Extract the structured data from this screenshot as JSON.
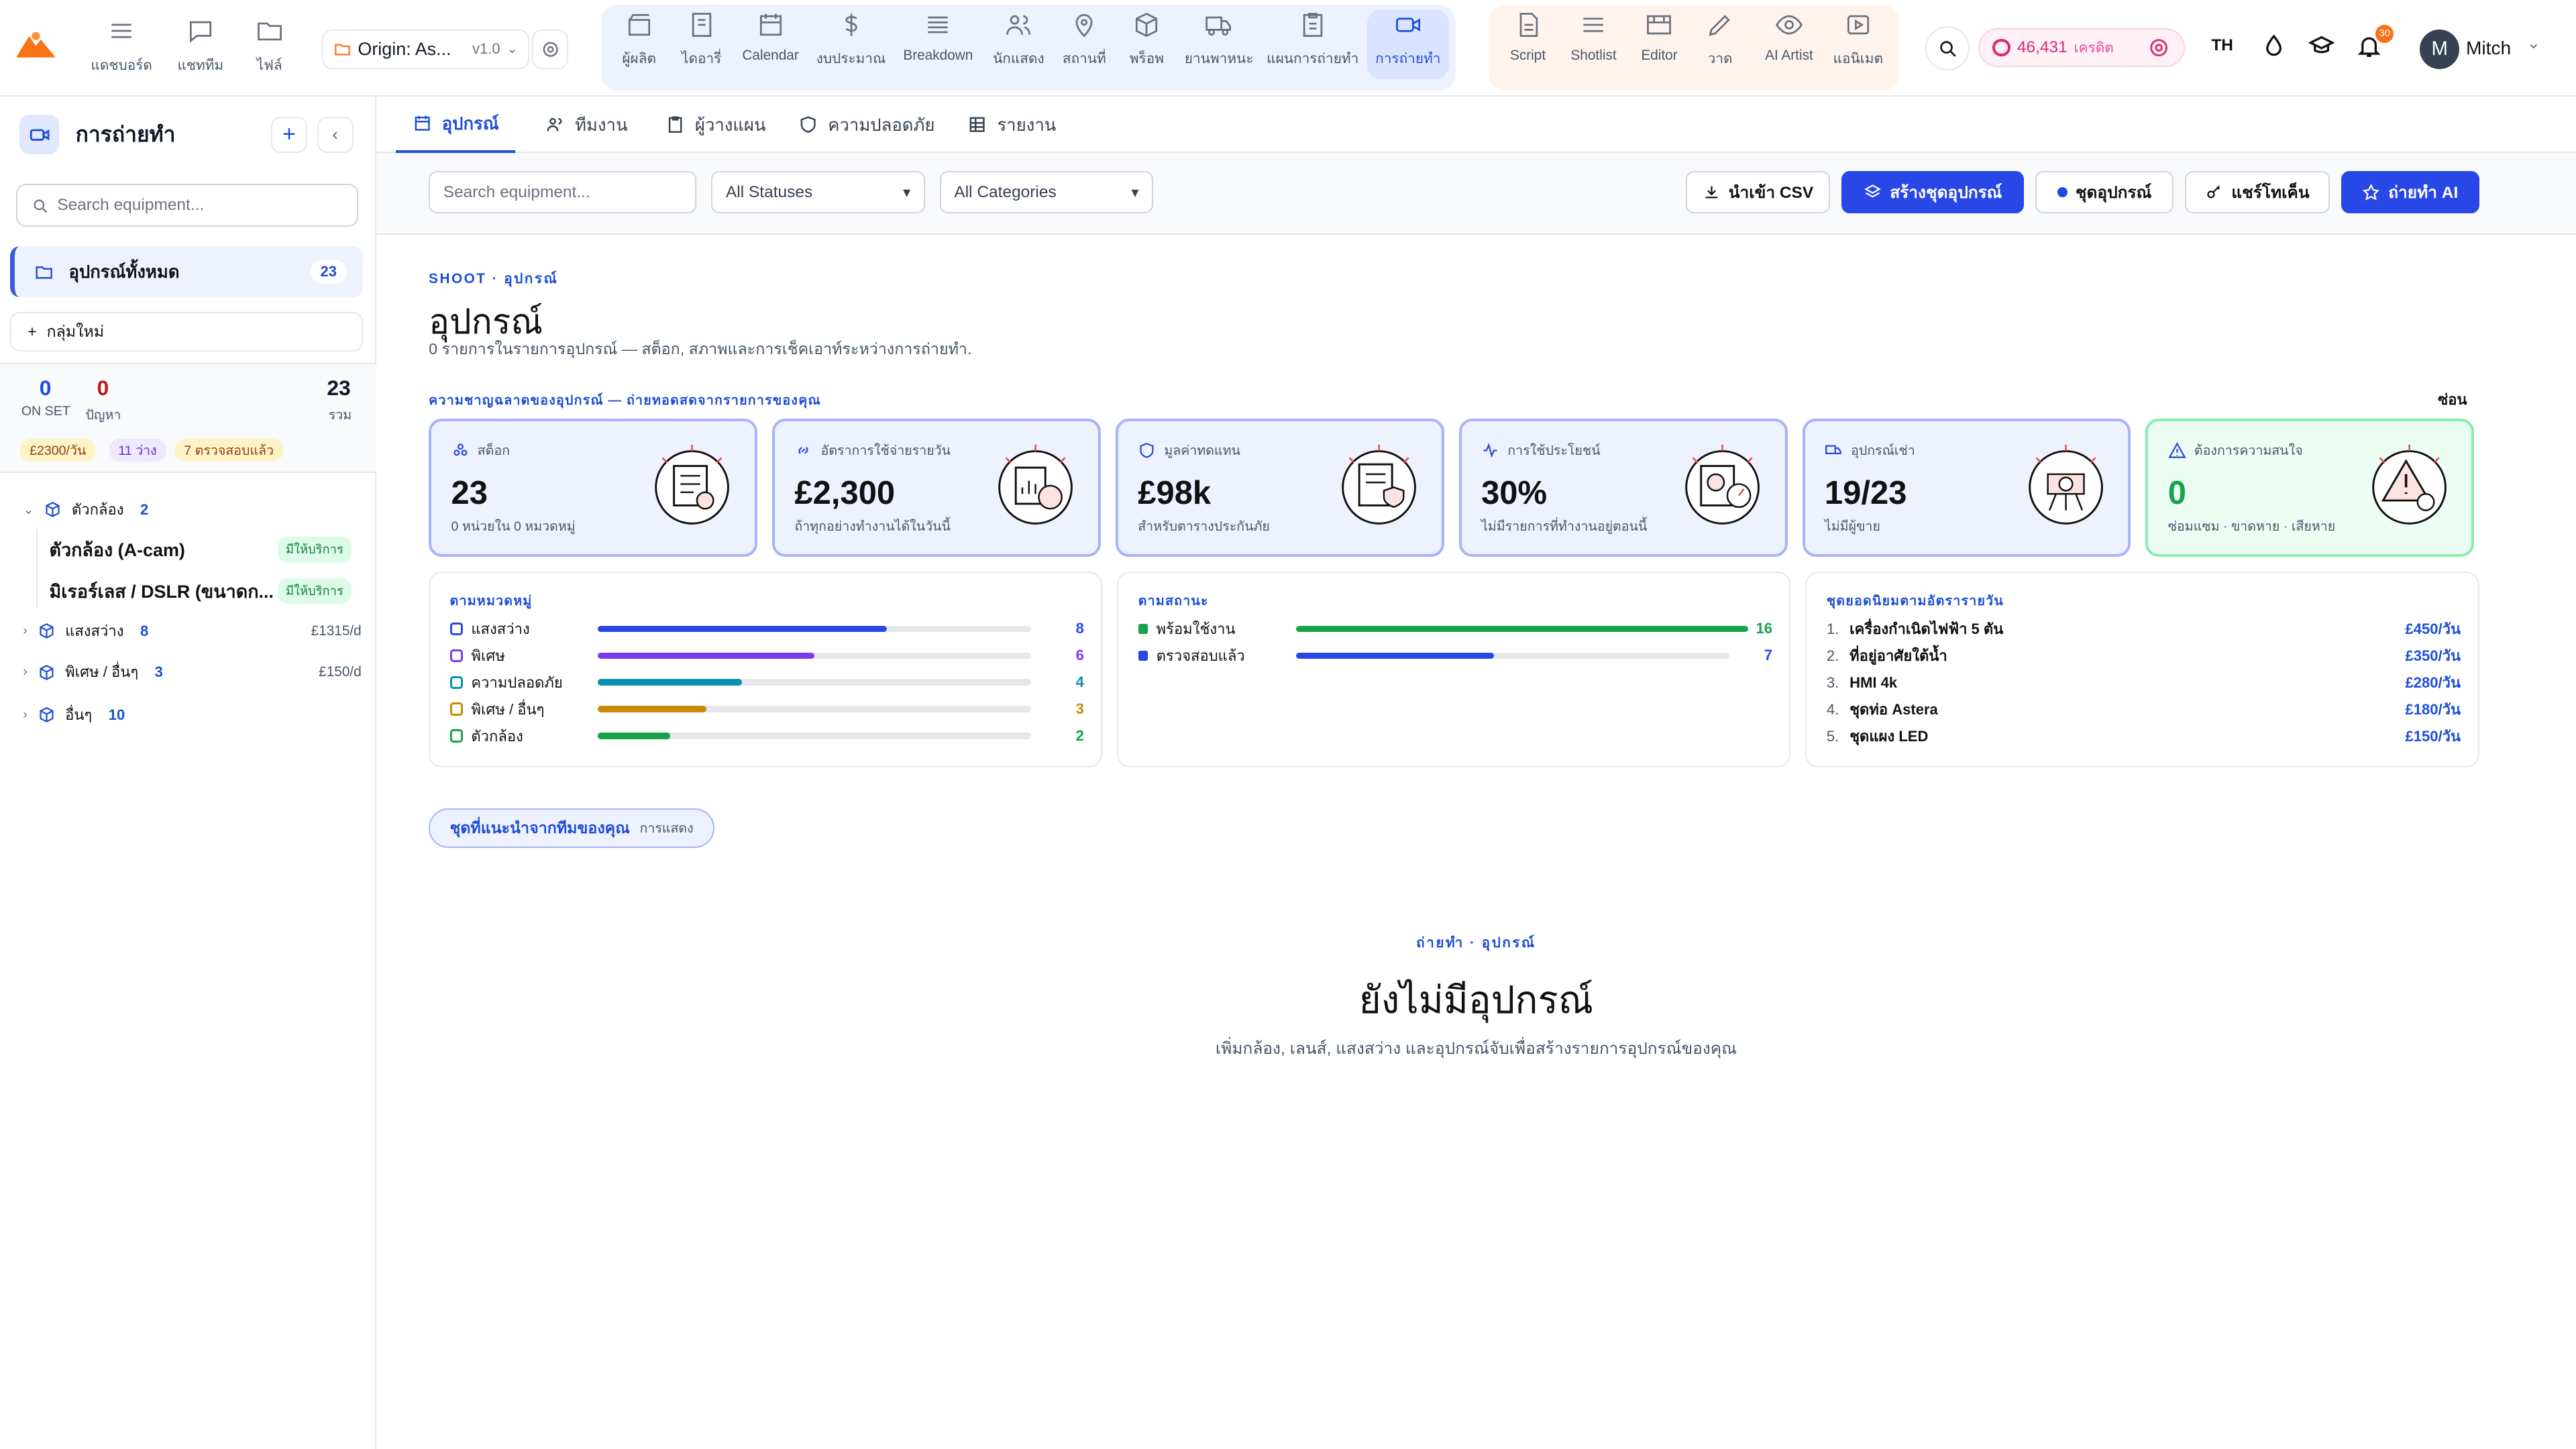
{
  "topnav": {
    "left": [
      {
        "label": "แดชบอร์ด",
        "icon": "menu-icon"
      },
      {
        "label": "แชททีม",
        "icon": "chat-icon"
      },
      {
        "label": "ไฟล์",
        "icon": "folder-icon"
      }
    ],
    "project": {
      "name": "Origin: As...",
      "version": "v1.0"
    },
    "group1": [
      {
        "label": "ผู้ผลิต",
        "icon": "clapper-icon"
      },
      {
        "label": "ไดอารี่",
        "icon": "notebook-icon"
      },
      {
        "label": "Calendar",
        "icon": "calendar-icon"
      },
      {
        "label": "งบประมาณ",
        "icon": "dollar-icon"
      },
      {
        "label": "Breakdown",
        "icon": "layers-icon"
      },
      {
        "label": "นักแสดง",
        "icon": "people-icon"
      },
      {
        "label": "สถานที่",
        "icon": "pin-icon"
      },
      {
        "label": "พร็อพ",
        "icon": "box-icon"
      },
      {
        "label": "ยานพาหนะ",
        "icon": "truck-icon"
      },
      {
        "label": "แผนการถ่ายทำ",
        "icon": "clipboard-icon"
      },
      {
        "label": "การถ่ายทำ",
        "icon": "camera-icon",
        "active": true
      }
    ],
    "group2": [
      {
        "label": "Script",
        "icon": "doc-icon"
      },
      {
        "label": "Shotlist",
        "icon": "list-icon"
      },
      {
        "label": "Editor",
        "icon": "film-icon"
      },
      {
        "label": "วาด",
        "icon": "pencil-icon"
      },
      {
        "label": "AI Artist",
        "icon": "eye-icon"
      },
      {
        "label": "แอนิเมต",
        "icon": "play-icon"
      }
    ],
    "credits": {
      "value": "46,431",
      "label": "เครดิต"
    },
    "lang": "TH",
    "notifications": "30",
    "user": {
      "initial": "M",
      "name": "Mitch"
    }
  },
  "sidebar": {
    "title": "การถ่ายทำ",
    "search_placeholder": "Search equipment...",
    "all": {
      "label": "อุปกรณ์ทั้งหมด",
      "count": "23"
    },
    "new_group": "กลุ่มใหม่",
    "stats": {
      "on_set": "0",
      "on_set_label": "ON SET",
      "issues": "0",
      "issues_label": "ปัญหา",
      "total": "23",
      "total_label": "รวม"
    },
    "chips": [
      "£2300/วัน",
      "11 ว่าง",
      "7 ตรวจสอบแล้ว"
    ],
    "tree": [
      {
        "label": "ตัวกล้อง",
        "count": "2",
        "rate": "",
        "expanded": true,
        "children": [
          {
            "label": "ตัวกล้อง (A-cam)",
            "badge": "มีให้บริการ"
          },
          {
            "label": "มิเรอร์เลส / DSLR (ขนาดก...",
            "badge": "มีให้บริการ"
          }
        ]
      },
      {
        "label": "แสงสว่าง",
        "count": "8",
        "rate": "£1315/d"
      },
      {
        "label": "พิเศษ / อื่นๆ",
        "count": "3",
        "rate": "£150/d"
      },
      {
        "label": "อื่นๆ",
        "count": "10",
        "rate": ""
      }
    ]
  },
  "tabs": [
    {
      "label": "อุปกรณ์",
      "icon": "calendar-icon",
      "active": true
    },
    {
      "label": "ทีมงาน",
      "icon": "people-icon"
    },
    {
      "label": "ผู้วางแผน",
      "icon": "clipboard-icon"
    },
    {
      "label": "ความปลอดภัย",
      "icon": "shield-icon"
    },
    {
      "label": "รายงาน",
      "icon": "grid-icon"
    }
  ],
  "filters": {
    "search_placeholder": "Search equipment...",
    "status": "All Statuses",
    "category": "All Categories",
    "import_csv": "นำเข้า CSV",
    "create_kit": "สร้างชุดอุปกรณ์",
    "kits": "ชุดอุปกรณ์",
    "share_token": "แชร์โทเค็น",
    "ai_shoot": "ถ่ายทำ AI"
  },
  "header": {
    "eyebrow": "SHOOT · อุปกรณ์",
    "title": "อุปกรณ์",
    "subtitle": "0 รายการในรายการอุปกรณ์ — สต็อก, สภาพและการเช็คเอาท์ระหว่างการถ่ายทำ."
  },
  "insights": {
    "title": "ความชาญฉลาดของอุปกรณ์ — ถ่ายทอดสดจากรายการของคุณ",
    "hide": "ซ่อน"
  },
  "cards": [
    {
      "title": "สต็อก",
      "value": "23",
      "sub": "0 หน่วยใน 0 หมวดหมู่",
      "icon": "stack-icon",
      "color": "blue"
    },
    {
      "title": "อัตราการใช้จ่ายรายวัน",
      "value": "£2,300",
      "sub": "ถ้าทุกอย่างทำงานได้ในวันนี้",
      "icon": "link-icon",
      "color": "blue"
    },
    {
      "title": "มูลค่าทดแทน",
      "value": "£98k",
      "sub": "สำหรับตารางประกันภัย",
      "icon": "shield-icon",
      "color": "blue"
    },
    {
      "title": "การใช้ประโยชน์",
      "value": "30%",
      "sub": "ไม่มีรายการที่ทำงานอยู่ตอนนี้",
      "icon": "pulse-icon",
      "color": "blue"
    },
    {
      "title": "อุปกรณ์เช่า",
      "value": "19/23",
      "sub": "ไม่มีผู้ขาย",
      "icon": "truck-icon",
      "color": "blue"
    },
    {
      "title": "ต้องการความสนใจ",
      "value": "0",
      "sub": "ซ่อมแซม · ขาดหาย · เสียหาย",
      "icon": "warning-icon",
      "color": "green"
    }
  ],
  "by_category": {
    "title": "ตามหมวดหมู่",
    "max": 8,
    "items": [
      {
        "label": "แสงสว่าง",
        "value": 8,
        "color": "#2847e6",
        "icon": "bulb-icon"
      },
      {
        "label": "พิเศษ",
        "value": 6,
        "color": "#7c3aed",
        "icon": "cube-icon"
      },
      {
        "label": "ความปลอดภัย",
        "value": 4,
        "color": "#0891b2",
        "icon": "cube-icon"
      },
      {
        "label": "พิเศษ / อื่นๆ",
        "value": 3,
        "color": "#ca8a04",
        "icon": "cube-icon"
      },
      {
        "label": "ตัวกล้อง",
        "value": 2,
        "color": "#16a34a",
        "icon": "camera-icon"
      }
    ]
  },
  "by_status": {
    "title": "ตามสถานะ",
    "max": 23,
    "items": [
      {
        "label": "พร้อมใช้งาน",
        "value": 16,
        "color": "#16a34a"
      },
      {
        "label": "ตรวจสอบแล้ว",
        "value": 7,
        "color": "#2847e6"
      }
    ]
  },
  "top_kits": {
    "title": "ชุดยอดนิยมตามอัตรารายวัน",
    "items": [
      {
        "rank": "1.",
        "label": "เครื่องกำเนิดไฟฟ้า 5 ตัน",
        "price": "£450/วัน"
      },
      {
        "rank": "2.",
        "label": "ที่อยู่อาศัยใต้น้ำ",
        "price": "£350/วัน"
      },
      {
        "rank": "3.",
        "label": "HMI 4k",
        "price": "£280/วัน"
      },
      {
        "rank": "4.",
        "label": "ชุดท่อ Astera",
        "price": "£180/วัน"
      },
      {
        "rank": "5.",
        "label": "ชุดแผง LED",
        "price": "£150/วัน"
      }
    ]
  },
  "suggested": {
    "label": "ชุดที่แนะนำจากทีมของคุณ",
    "sub": "การแสดง"
  },
  "empty": {
    "eyebrow": "ถ่ายทำ · อุปกรณ์",
    "title": "ยังไม่มีอุปกรณ์",
    "sub": "เพิ่มกล้อง, เลนส์, แสงสว่าง และอุปกรณ์จับเพื่อสร้างรายการอุปกรณ์ของคุณ"
  },
  "colors": {
    "accent": "#2847e6",
    "green": "#16a34a",
    "pink": "#db2777"
  }
}
